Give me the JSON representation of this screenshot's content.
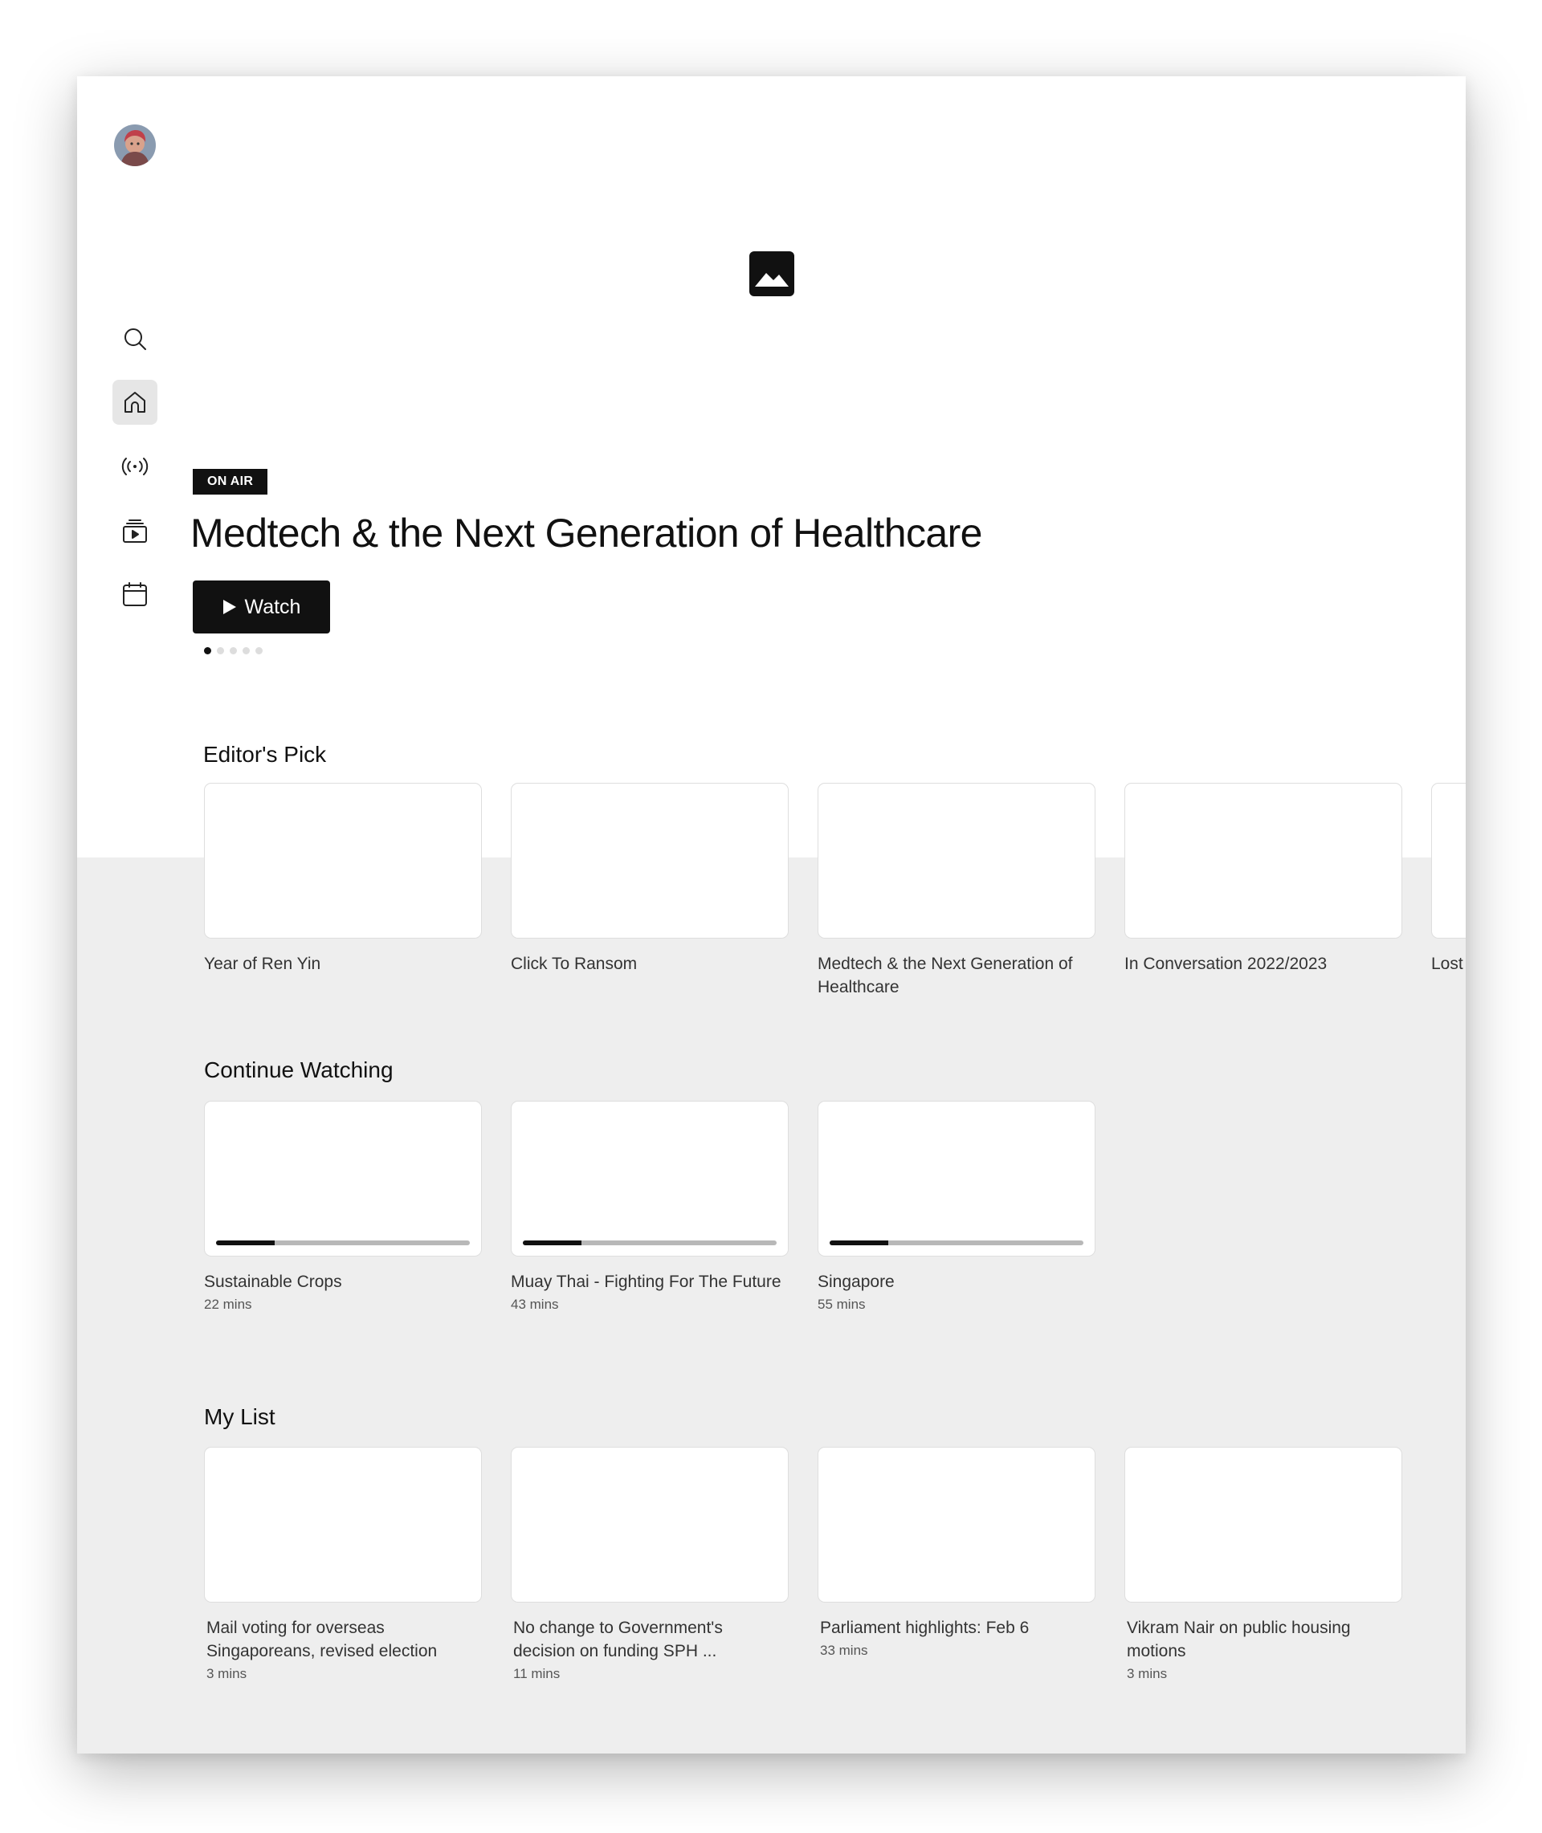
{
  "sidebar": {
    "avatar": "user-avatar",
    "items": [
      {
        "id": "search",
        "icon": "search-icon",
        "active": false
      },
      {
        "id": "home",
        "icon": "home-icon",
        "active": true
      },
      {
        "id": "live",
        "icon": "broadcast-icon",
        "active": false
      },
      {
        "id": "videos",
        "icon": "video-library-icon",
        "active": false
      },
      {
        "id": "schedule",
        "icon": "calendar-icon",
        "active": false
      }
    ]
  },
  "hero": {
    "badge": "ON AIR",
    "title": "Medtech & the Next Generation of Healthcare",
    "watch_label": "Watch",
    "carousel": {
      "count": 5,
      "active_index": 0
    },
    "image_icon": "image-placeholder-icon"
  },
  "editors_pick": {
    "title": "Editor's Pick",
    "items": [
      {
        "title": "Year of Ren Yin"
      },
      {
        "title": "Click To Ransom"
      },
      {
        "title": "Medtech & the Next Generation of Healthcare"
      },
      {
        "title": "In Conversation 2022/2023"
      },
      {
        "title": "Lost"
      }
    ]
  },
  "continue_watching": {
    "title": "Continue Watching",
    "items": [
      {
        "title": "Sustainable Crops",
        "duration": "22 mins",
        "progress": 0.23
      },
      {
        "title": "Muay Thai - Fighting For The Future",
        "duration": "43 mins",
        "progress": 0.23
      },
      {
        "title": "Singapore",
        "duration": "55 mins",
        "progress": 0.23
      }
    ]
  },
  "my_list": {
    "title": "My List",
    "items": [
      {
        "title": "Mail voting for overseas Singaporeans, revised election",
        "duration": "3 mins"
      },
      {
        "title": "No change to Government's decision on funding SPH ...",
        "duration": "11 mins"
      },
      {
        "title": "Parliament highlights: Feb 6",
        "duration": "33 mins"
      },
      {
        "title": "Vikram Nair on public housing motions",
        "duration": "3 mins"
      }
    ]
  },
  "colors": {
    "accent": "#111111",
    "page_bg": "#eeeeee",
    "hero_bg": "#ffffff",
    "progress_track": "#b8b8b8"
  }
}
